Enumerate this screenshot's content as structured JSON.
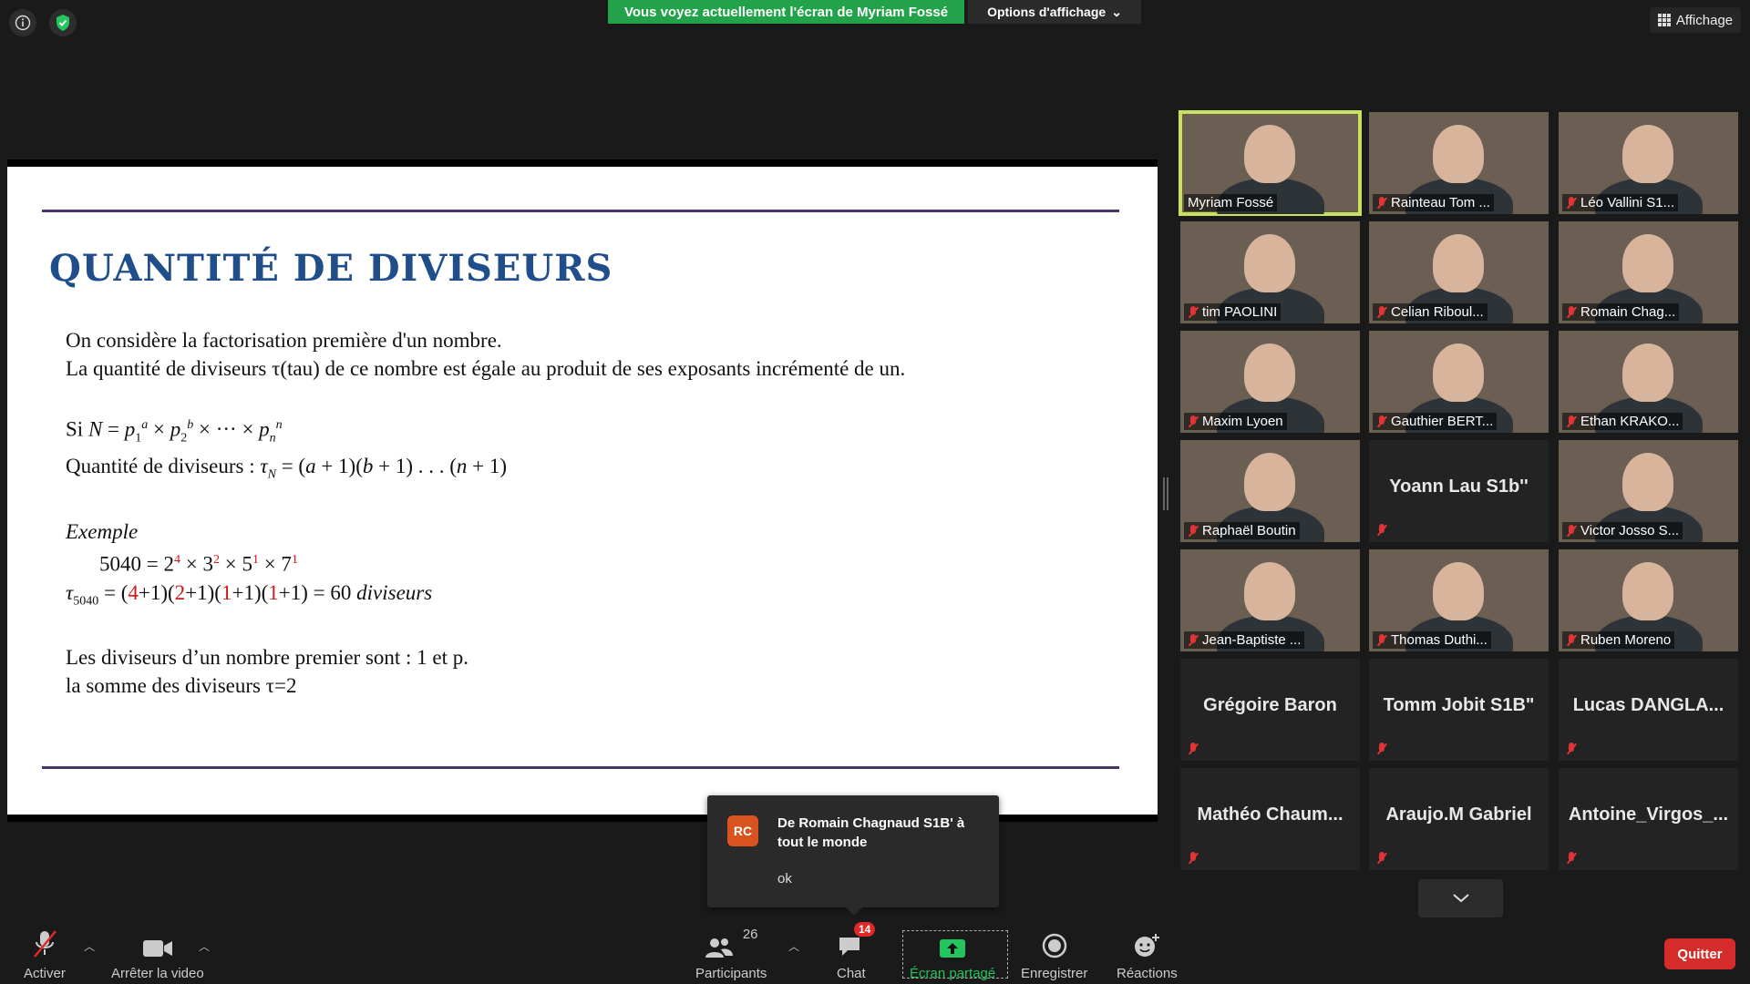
{
  "top": {
    "share_banner": "Vous voyez actuellement l'écran de Myriam Fossé",
    "view_options": "Options d'affichage",
    "layout_button": "Affichage"
  },
  "slide": {
    "title": "QUANTITÉ DE DIVISEURS",
    "line1": "On considère la factorisation première d'un nombre.",
    "line2": "La quantité de diviseurs τ(tau) de ce nombre est égale au produit de ses exposants incrémenté de un.",
    "si_prefix": "Si",
    "qty_label": "Quantité de diviseurs :",
    "example_label": "Exemple",
    "result_word": "diviseurs",
    "prime_line": "Les diviseurs d’un nombre premier sont : 1 et p.",
    "sum_line": "la somme des diviseurs τ=2"
  },
  "participants": [
    {
      "name": "Myriam Fossé",
      "video": true,
      "active": true
    },
    {
      "name": "Rainteau Tom ...",
      "video": true
    },
    {
      "name": "Léo Vallini S1...",
      "video": true
    },
    {
      "name": "tim PAOLINI",
      "video": true
    },
    {
      "name": "Celian Riboul...",
      "video": true
    },
    {
      "name": "Romain Chag...",
      "video": true
    },
    {
      "name": "Maxim Lyoen",
      "video": true
    },
    {
      "name": "Gauthier BERT...",
      "video": true
    },
    {
      "name": "Ethan KRAKO...",
      "video": true
    },
    {
      "name": "Raphaël Boutin",
      "video": true
    },
    {
      "name": "Yoann Lau S1b''",
      "video": false
    },
    {
      "name": "Victor Josso S...",
      "video": true
    },
    {
      "name": "Jean-Baptiste ...",
      "video": true
    },
    {
      "name": "Thomas Duthi...",
      "video": true
    },
    {
      "name": "Ruben Moreno",
      "video": true
    },
    {
      "name": "Grégoire Baron",
      "video": false
    },
    {
      "name": "Tomm Jobit S1B\"",
      "video": false
    },
    {
      "name": "Lucas  DANGLA...",
      "video": false
    },
    {
      "name": "Mathéo  Chaum...",
      "video": false
    },
    {
      "name": "Araujo.M Gabriel",
      "video": false
    },
    {
      "name": "Antoine_Virgos_...",
      "video": false
    }
  ],
  "chat_popup": {
    "initials": "RC",
    "from": "De Romain Chagnaud S1B' à tout le monde",
    "message": "ok"
  },
  "toolbar": {
    "mute_label": "Activer",
    "video_label": "Arrêter la video",
    "participants_count": "26",
    "participants_label": "Participants",
    "chat_label": "Chat",
    "chat_badge": "14",
    "share_label": "Écran partagé",
    "record_label": "Enregistrer",
    "reactions_label": "Réactions",
    "quit_label": "Quitter"
  },
  "colors": {
    "share_green": "#22a34a",
    "slide_title_blue": "#1f4e8a",
    "exponent_red": "#d01818",
    "active_speaker": "#c9e25c",
    "quit_red": "#d52b2b"
  }
}
